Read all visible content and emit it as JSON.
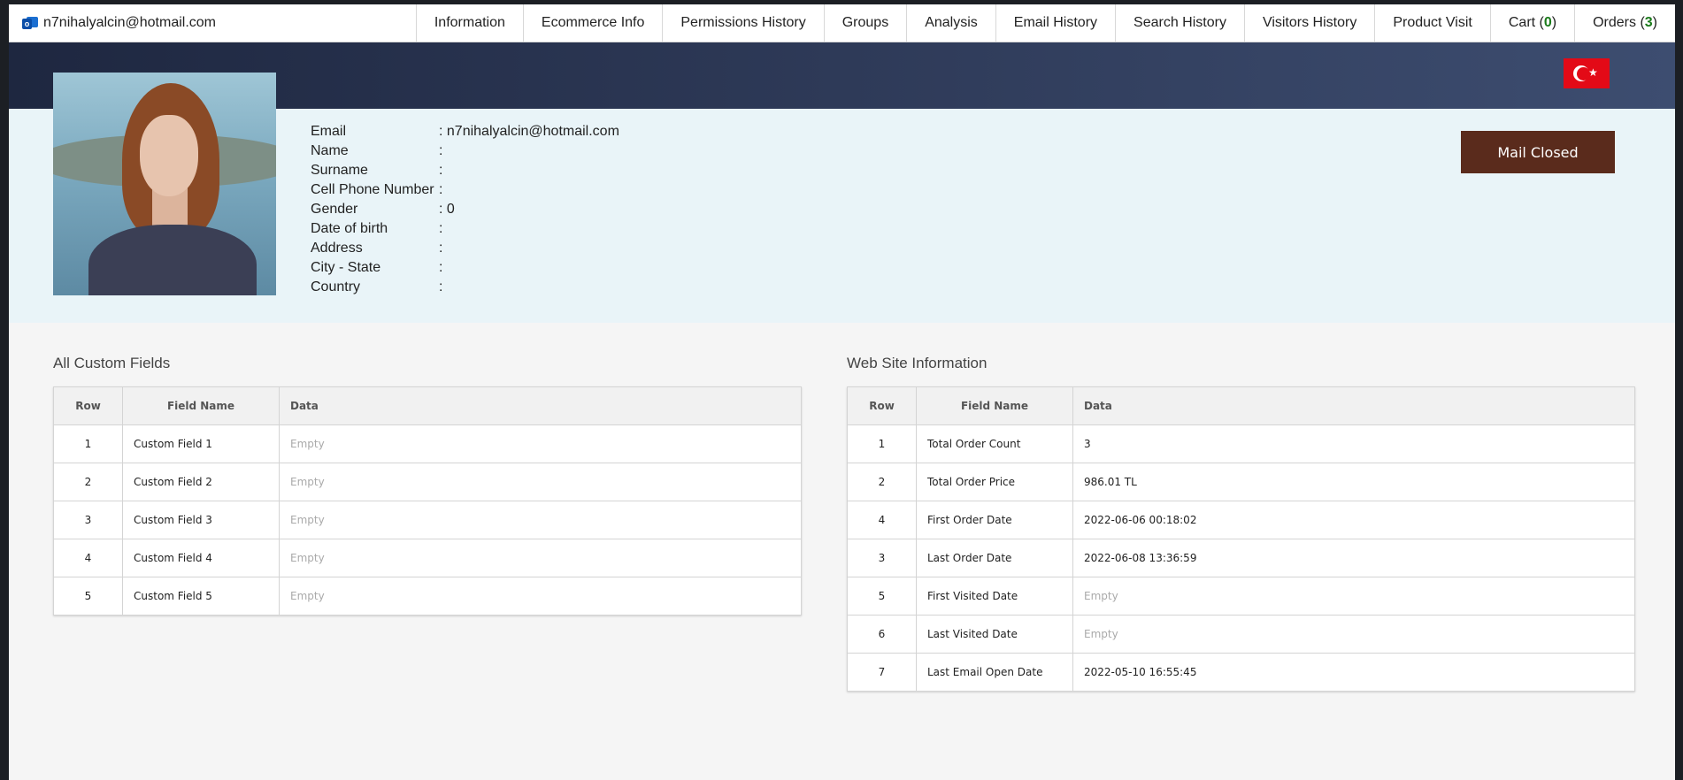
{
  "header": {
    "email": "n7nihalyalcin@hotmail.com",
    "tabs": [
      {
        "label": "Information"
      },
      {
        "label": "Ecommerce Info"
      },
      {
        "label": "Permissions History"
      },
      {
        "label": "Groups"
      },
      {
        "label": "Analysis"
      },
      {
        "label": "Email History"
      },
      {
        "label": "Search History"
      },
      {
        "label": "Visitors History"
      },
      {
        "label": "Product Visit"
      },
      {
        "label": "Cart (",
        "count": "0",
        "suffix": ")"
      },
      {
        "label": "Orders (",
        "count": "3",
        "suffix": ")"
      }
    ]
  },
  "flag_country": "turkey-flag-icon",
  "profile": {
    "fields": [
      {
        "label": "Email",
        "value": ": n7nihalyalcin@hotmail.com"
      },
      {
        "label": "Name",
        "value": ":"
      },
      {
        "label": "Surname",
        "value": ":"
      },
      {
        "label": "Cell Phone Number",
        "value": ":"
      },
      {
        "label": "Gender",
        "value": ": 0"
      },
      {
        "label": "Date of birth",
        "value": ":"
      },
      {
        "label": "Address",
        "value": ":"
      },
      {
        "label": "City - State",
        "value": ":"
      },
      {
        "label": "Country",
        "value": ":"
      }
    ],
    "mail_button": "Mail Closed"
  },
  "custom_fields": {
    "title": "All Custom Fields",
    "headers": [
      "Row",
      "Field Name",
      "Data"
    ],
    "rows": [
      [
        "1",
        "Custom Field 1",
        "Empty"
      ],
      [
        "2",
        "Custom Field 2",
        "Empty"
      ],
      [
        "3",
        "Custom Field 3",
        "Empty"
      ],
      [
        "4",
        "Custom Field 4",
        "Empty"
      ],
      [
        "5",
        "Custom Field 5",
        "Empty"
      ]
    ]
  },
  "website_info": {
    "title": "Web Site Information",
    "headers": [
      "Row",
      "Field Name",
      "Data"
    ],
    "rows": [
      [
        "1",
        "Total Order Count",
        "3"
      ],
      [
        "2",
        "Total Order Price",
        "986.01 TL"
      ],
      [
        "4",
        "First Order Date",
        "2022-06-06 00:18:02"
      ],
      [
        "3",
        "Last Order Date",
        "2022-06-08 13:36:59"
      ],
      [
        "5",
        "First Visited Date",
        "Empty"
      ],
      [
        "6",
        "Last Visited Date",
        "Empty"
      ],
      [
        "7",
        "Last Email Open Date",
        "2022-05-10 16:55:45"
      ]
    ]
  },
  "colors": {
    "mail_button": "#5a2b1c",
    "count_green": "#1a7a1a",
    "banner": "#2e3a58"
  }
}
